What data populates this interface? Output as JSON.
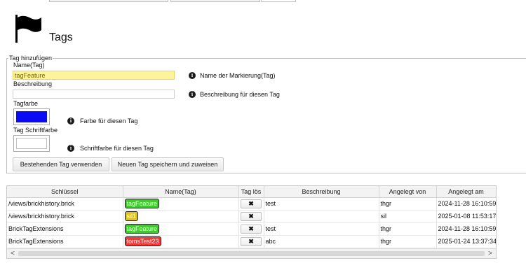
{
  "header": {
    "title": "Tags",
    "icon": "flag-icon"
  },
  "form": {
    "legend": "Tag hinzufügen",
    "name_label": "Name(Tag)",
    "name_value": "tagFeature",
    "name_hint": "Name der Markierung(Tag)",
    "desc_label": "Beschreibung",
    "desc_value": "",
    "desc_hint": "Beschreibung für diesen Tag",
    "color_label": "Tagfarbe",
    "color_value": "#0a0af5",
    "color_hint": "Farbe für diesen Tag",
    "fontcolor_label": "Tag Schriftfarbe",
    "fontcolor_value": "#ffffff",
    "fontcolor_hint": "Schriftfarbe für diesen Tag",
    "btn_existing": "Bestehenden Tag verwenden",
    "btn_save": "Neuen Tag speichern und zuweisen"
  },
  "table": {
    "columns": [
      "Schlüssel",
      "Name(Tag)",
      "Tag lös",
      "Beschreibung",
      "Angelegt von",
      "Angelegt am"
    ],
    "rows": [
      {
        "key": "/views/brickhistory.brick",
        "tag": "tagFeature",
        "tag_bg": "#3bcc28",
        "tag_fg": "#ffffff",
        "remove": "✖",
        "desc": "test",
        "by": "thgr",
        "at": "2024-11-28 16:10:59"
      },
      {
        "key": "/views/brickhistory.brick",
        "tag": "sil1",
        "tag_bg": "#e0c21d",
        "tag_fg": "#ffffff",
        "remove": "✖",
        "desc": "",
        "by": "sil",
        "at": "2025-01-08 11:53:17"
      },
      {
        "key": "BrickTagExtensions",
        "tag": "tagFeature",
        "tag_bg": "#3bcc28",
        "tag_fg": "#ffffff",
        "remove": "✖",
        "desc": "test",
        "by": "thgr",
        "at": "2024-11-28 16:10:59"
      },
      {
        "key": "BrickTagExtensions",
        "tag": "tomsTest23",
        "tag_bg": "#f03a3a",
        "tag_fg": "#ffffff",
        "remove": "✖",
        "desc": "abc",
        "by": "thgr",
        "at": "2025-01-24 13:37:34"
      }
    ]
  },
  "scrollbar": {
    "left_arrow": "<",
    "right_arrow": ">"
  }
}
